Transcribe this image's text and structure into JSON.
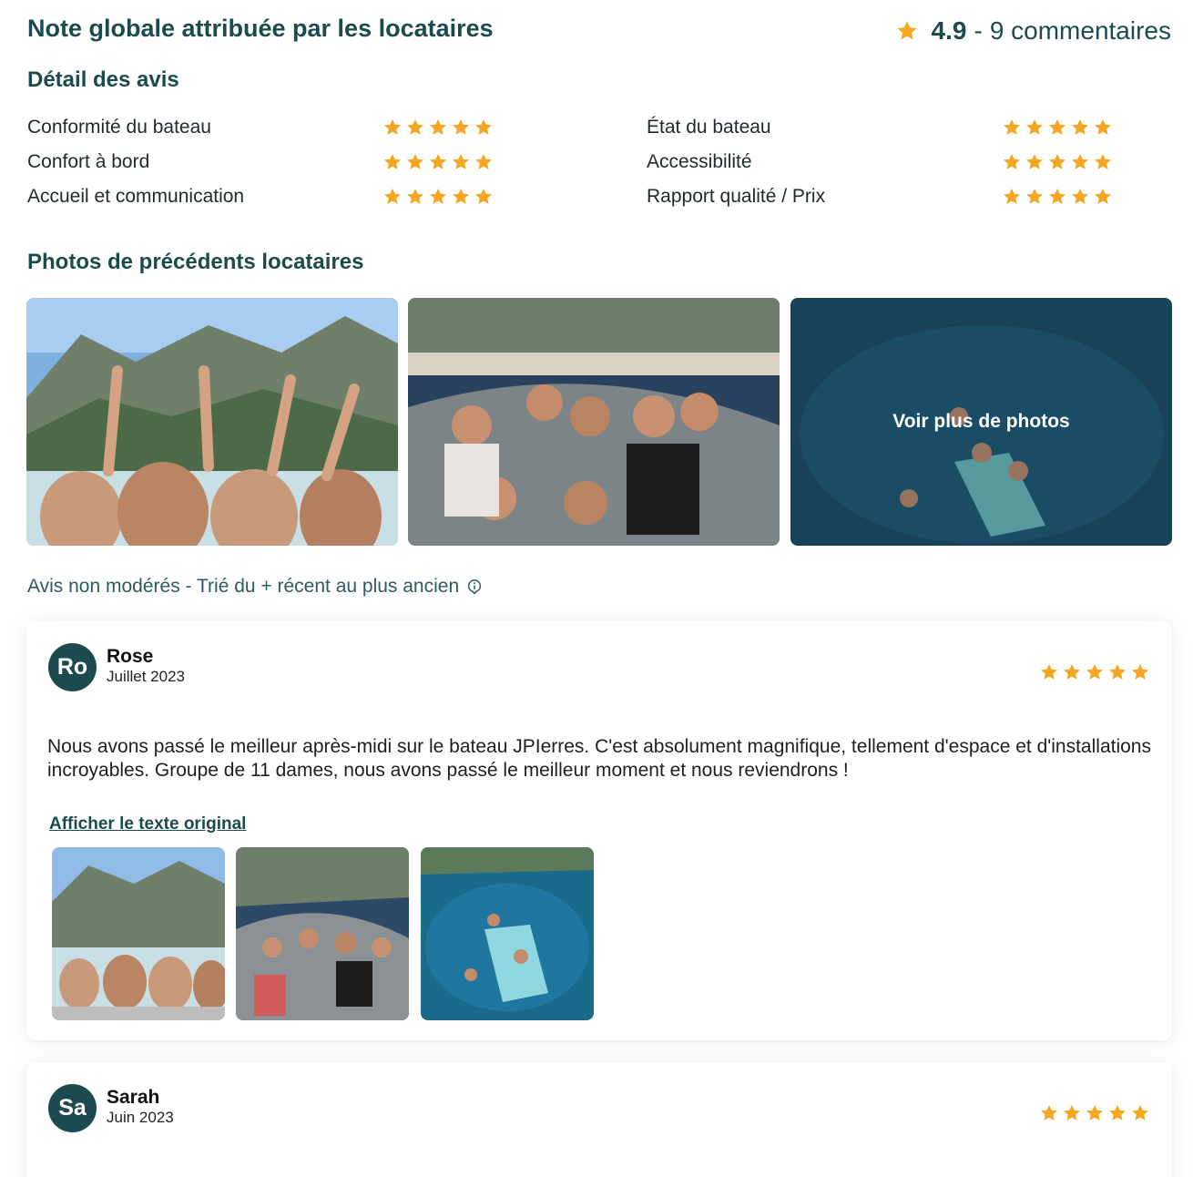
{
  "header": {
    "title": "Note globale attribuée par les locataires",
    "score": "4.9",
    "separator": "-",
    "comments": "9 commentaires"
  },
  "details": {
    "title": "Détail des avis",
    "criteria": [
      {
        "label": "Conformité du bateau",
        "rating": 5
      },
      {
        "label": "État du bateau",
        "rating": 5
      },
      {
        "label": "Confort à bord",
        "rating": 5
      },
      {
        "label": "Accessibilité",
        "rating": 5
      },
      {
        "label": "Accueil et communication",
        "rating": 5
      },
      {
        "label": "Rapport qualité / Prix",
        "rating": 5
      }
    ]
  },
  "photos": {
    "title": "Photos de précédents locataires",
    "more_label": "Voir plus de photos"
  },
  "sort_note": "Avis non modérés - Trié du + récent au plus ancien",
  "reviews": [
    {
      "initials": "Ro",
      "name": "Rose",
      "date": "Juillet 2023",
      "rating": 5,
      "text": "Nous avons passé le meilleur après-midi sur le bateau JPIerres. C'est absolument magnifique, tellement d'espace et d'installations incroyables. Groupe de 11 dames, nous avons passé le meilleur moment et nous reviendrons !",
      "original_link": "Afficher le texte original"
    },
    {
      "initials": "Sa",
      "name": "Sarah",
      "date": "Juin 2023",
      "rating": 5
    }
  ],
  "colors": {
    "brand": "#1b4b4f",
    "star": "#f5a623"
  },
  "icons": {
    "star": "star-icon",
    "info": "info-icon"
  }
}
